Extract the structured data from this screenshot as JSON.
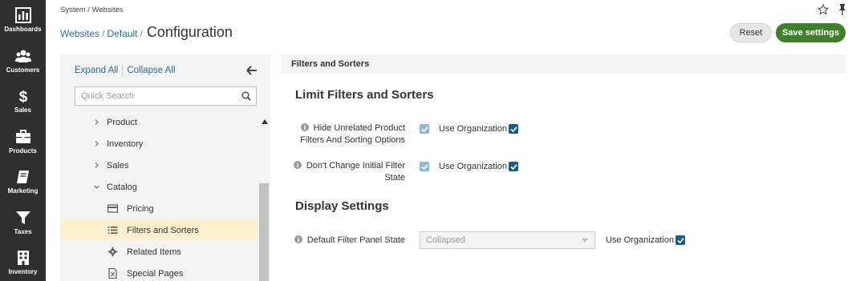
{
  "nav": {
    "items": [
      {
        "label": "Dashboards",
        "icon": "bar-chart-icon"
      },
      {
        "label": "Customers",
        "icon": "users-icon"
      },
      {
        "label": "Sales",
        "icon": "dollar-icon"
      },
      {
        "label": "Products",
        "icon": "briefcase-icon"
      },
      {
        "label": "Marketing",
        "icon": "book-icon"
      },
      {
        "label": "Taxes",
        "icon": "filter-icon"
      },
      {
        "label": "Inventory",
        "icon": "building-icon"
      }
    ]
  },
  "header": {
    "breadcrumb_top": "System / Websites",
    "crumbs": [
      "Websites",
      "Default"
    ],
    "separator": "/",
    "title": "Configuration",
    "reset_label": "Reset",
    "save_label": "Save settings"
  },
  "tree": {
    "expand_all": "Expand All",
    "collapse_all": "Collapse All",
    "search_placeholder": "Quick Search",
    "items": [
      {
        "label": "Product",
        "state": "collapsed"
      },
      {
        "label": "Inventory",
        "state": "collapsed"
      },
      {
        "label": "Sales",
        "state": "collapsed"
      },
      {
        "label": "Catalog",
        "state": "expanded"
      }
    ],
    "children": [
      {
        "label": "Pricing",
        "icon": "credit-card-icon"
      },
      {
        "label": "Filters and Sorters",
        "icon": "list-icon",
        "active": true
      },
      {
        "label": "Related Items",
        "icon": "cog-icon"
      },
      {
        "label": "Special Pages",
        "icon": "file-icon"
      }
    ]
  },
  "main": {
    "section_title": "Filters and Sorters",
    "groups": [
      {
        "title": "Limit Filters and Sorters",
        "fields": [
          {
            "label_line1": "Hide Unrelated Product",
            "label_line2": "Filters And Sorting Options",
            "checked": true,
            "use_org_label": "Use Organization",
            "use_org_checked": true
          },
          {
            "label_line1": "Don't Change Initial Filter",
            "label_line2": "State",
            "checked": true,
            "use_org_label": "Use Organization",
            "use_org_checked": true
          }
        ]
      },
      {
        "title": "Display Settings",
        "fields": [
          {
            "label": "Default Filter Panel State",
            "select_value": "Collapsed",
            "use_org_label": "Use Organization",
            "use_org_checked": true
          }
        ]
      }
    ]
  },
  "colors": {
    "nav_bg": "#2f2f2f",
    "link": "#2a6d96",
    "save_button": "#3f7f2a",
    "active_item": "#fdf0cf",
    "checkbox_on": "#1c5d86",
    "checkbox_inherited": "#8dbbd1"
  }
}
